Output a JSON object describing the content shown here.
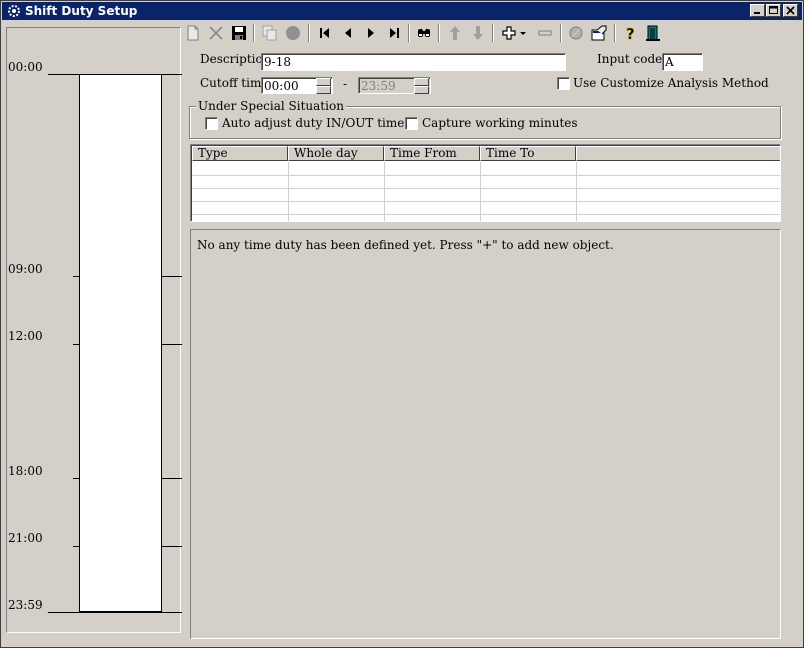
{
  "window": {
    "title": "Shift Duty Setup",
    "app_icon": "gear-icon",
    "controls": [
      "minimize-icon",
      "maximize-icon",
      "close-icon"
    ]
  },
  "timeline": {
    "labels": [
      "00:00",
      "09:00",
      "12:00",
      "18:00",
      "21:00",
      "23:59"
    ]
  },
  "toolbar": {
    "buttons": [
      "new-icon",
      "delete-icon",
      "save-icon",
      "copy-icon",
      "record-icon",
      "first-icon",
      "previous-icon",
      "next-icon",
      "last-icon",
      "find-icon",
      "move-up-icon",
      "move-down-icon",
      "add-icon",
      "dropdown-icon",
      "remove-icon",
      "disabled-circle-icon",
      "properties-icon",
      "help-icon",
      "exit-icon"
    ]
  },
  "form": {
    "description_label": "Description",
    "description_value": "9-18",
    "input_code_label": "Input code :",
    "input_code_value": "A",
    "cutoff_label": "Cutoff time",
    "cutoff_from": "00:00",
    "cutoff_dash": "-",
    "cutoff_to": "23:59",
    "customize_label": "Use Customize Analysis Method",
    "customize_checked": false
  },
  "special": {
    "legend": "Under Special Situation",
    "auto_adjust_label": "Auto adjust duty IN/OUT time",
    "capture_label": "Capture working minutes"
  },
  "grid": {
    "columns": [
      "Type",
      "Whole day",
      "Time From",
      "Time To"
    ],
    "rows": []
  },
  "message": "No any time duty has been defined yet. Press \"+\" to add new object.",
  "colors": {
    "title_bar": "#0a246a",
    "face": "#d4d0c8"
  }
}
